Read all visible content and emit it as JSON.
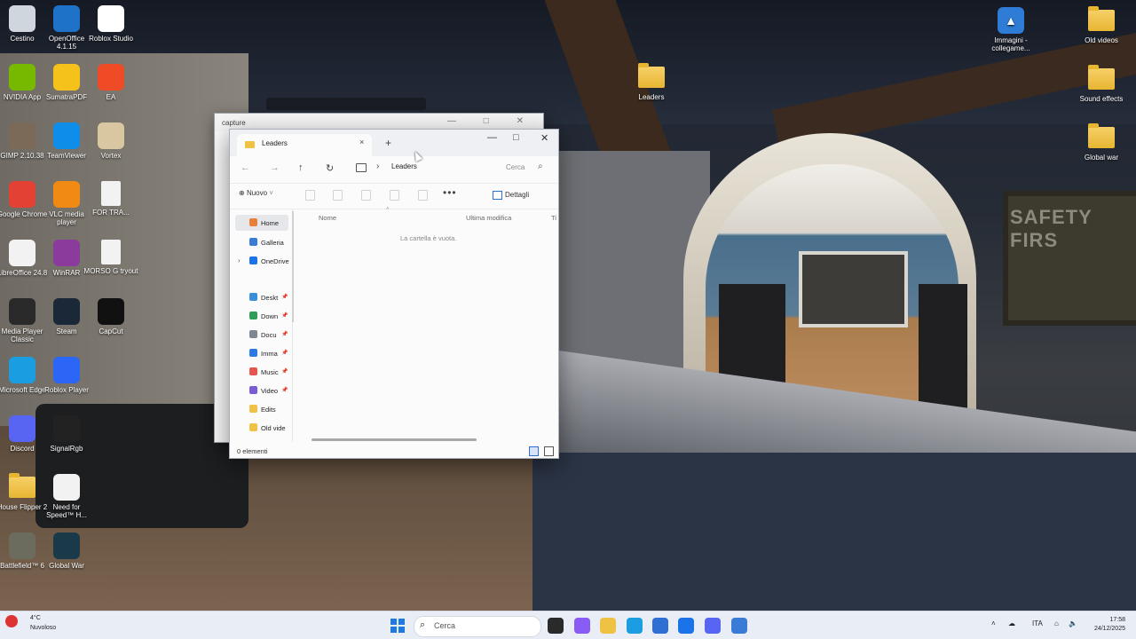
{
  "desktop_icons_left": [
    {
      "label": "Cestino",
      "icon": "recycle-bin-icon",
      "color": "#cfd6dd"
    },
    {
      "label": "OpenOffice 4.1.15",
      "icon": "openoffice-icon",
      "color": "#1e72c8"
    },
    {
      "label": "Roblox Studio",
      "icon": "roblox-studio-icon",
      "color": "#ffffff"
    },
    {
      "label": "NVIDIA App",
      "icon": "nvidia-icon",
      "color": "#76b900"
    },
    {
      "label": "SumatraPDF",
      "icon": "pdf-icon",
      "color": "#f4c21b"
    },
    {
      "label": "EA",
      "icon": "ea-icon",
      "color": "#ef4b26"
    },
    {
      "label": "GIMP 2.10.38",
      "icon": "gimp-icon",
      "color": "#7b6a57"
    },
    {
      "label": "TeamViewer",
      "icon": "teamviewer-icon",
      "color": "#0e8ee9"
    },
    {
      "label": "Vortex",
      "icon": "vortex-icon",
      "color": "#d8c7a0"
    },
    {
      "label": "Google Chrome",
      "icon": "chrome-icon",
      "color": "#e34133"
    },
    {
      "label": "VLC media player",
      "icon": "vlc-icon",
      "color": "#f08a12"
    },
    {
      "label": "FOR TRA...",
      "icon": "document-icon",
      "color": "#f2f2f2"
    },
    {
      "label": "LibreOffice 24.8",
      "icon": "libreoffice-icon",
      "color": "#f2f2f2"
    },
    {
      "label": "WinRAR",
      "icon": "winrar-icon",
      "color": "#8b3b9b"
    },
    {
      "label": "MORSO G tryout",
      "icon": "document-icon",
      "color": "#f2f2f2"
    },
    {
      "label": "Media Player Classic",
      "icon": "mpc-icon",
      "color": "#2a2a2a"
    },
    {
      "label": "Steam",
      "icon": "steam-icon",
      "color": "#1b2838"
    },
    {
      "label": "CapCut",
      "icon": "capcut-icon",
      "color": "#111111"
    },
    {
      "label": "Microsoft Edge",
      "icon": "edge-icon",
      "color": "#1b9de2"
    },
    {
      "label": "Roblox Player",
      "icon": "roblox-player-icon",
      "color": "#2b66f6"
    },
    {
      "label": "Discord",
      "icon": "discord-icon",
      "color": "#5865f2"
    },
    {
      "label": "SignalRgb",
      "icon": "signalrgb-icon",
      "color": "#222222"
    },
    {
      "label": "House Flipper 2",
      "icon": "folder-icon",
      "color": "#f0c244"
    },
    {
      "label": "Need for Speed™ H...",
      "icon": "nfs-icon",
      "color": "#f2f2f2"
    },
    {
      "label": "Battlefield™ 6",
      "icon": "battlefield-icon",
      "color": "#6b6b5e"
    },
    {
      "label": "Global War",
      "icon": "global-war-icon",
      "color": "#1a3a4a"
    }
  ],
  "desktop_icons_right": [
    {
      "label": "Leaders",
      "icon": "folder-icon"
    },
    {
      "label": "Immagini - collegame...",
      "icon": "pictures-shortcut-icon"
    },
    {
      "label": "Old videos",
      "icon": "folder-icon"
    },
    {
      "label": "Sound effects",
      "icon": "folder-icon"
    },
    {
      "label": "Global war",
      "icon": "folder-icon"
    }
  ],
  "wallpaper": {
    "sign_text": "SAFETY FIRS"
  },
  "back_window": {
    "tab_label": "capture"
  },
  "explorer": {
    "tab_label": "Leaders",
    "tab_close": "×",
    "tab_add": "+",
    "window_controls": {
      "minimize": "—",
      "maximize": "□",
      "close": "✕"
    },
    "nav": {
      "back": "←",
      "forward": "→",
      "up": "↑",
      "refresh": "↻"
    },
    "breadcrumb_sep": "›",
    "breadcrumb": "Leaders",
    "search_placeholder": "Cerca",
    "search_icon": "⌕",
    "new_label": "Nuovo",
    "more_label": "•••",
    "details_label": "Dettagli",
    "sidebar": [
      {
        "label": "Home",
        "icon": "home-icon",
        "color": "#e8803a",
        "active": true
      },
      {
        "label": "Galleria",
        "icon": "gallery-icon",
        "color": "#3a7bd5"
      },
      {
        "label": "OneDrive",
        "icon": "onedrive-icon",
        "color": "#1a73e8",
        "expander": "›"
      },
      {
        "label": "Deskt",
        "icon": "desktop-icon",
        "color": "#3b8fd9",
        "pin": "📌"
      },
      {
        "label": "Down",
        "icon": "download-icon",
        "color": "#2f9e5b",
        "pin": "📌"
      },
      {
        "label": "Docu",
        "icon": "documents-icon",
        "color": "#7d8894",
        "pin": "📌"
      },
      {
        "label": "Imma",
        "icon": "pictures-icon",
        "color": "#2c7be5",
        "pin": "📌"
      },
      {
        "label": "Music",
        "icon": "music-icon",
        "color": "#e5554f",
        "pin": "📌"
      },
      {
        "label": "Video",
        "icon": "videos-icon",
        "color": "#7a5cd6",
        "pin": "📌"
      },
      {
        "label": "Edits",
        "icon": "folder-icon",
        "color": "#f0c244"
      },
      {
        "label": "Old vide",
        "icon": "folder-icon",
        "color": "#f0c244"
      }
    ],
    "columns": {
      "name": "Nome",
      "modified": "Ultima modifica",
      "type": "Ti"
    },
    "empty_message": "La cartella è vuota.",
    "status": "0 elementi"
  },
  "taskbar": {
    "weather_temp": "4°C",
    "weather_desc": "Nuvoloso",
    "search_placeholder": "Cerca",
    "language": "ITA",
    "time": "17:58",
    "date": "24/12/2025",
    "apps": [
      {
        "name": "task-view-icon",
        "color": "#2a2a2a"
      },
      {
        "name": "copilot-icon",
        "color": "#8a5cf6"
      },
      {
        "name": "file-explorer-icon",
        "color": "#f0c244"
      },
      {
        "name": "edge-icon",
        "color": "#1b9de2"
      },
      {
        "name": "store-icon",
        "color": "#2f6fd3"
      },
      {
        "name": "outlook-icon",
        "color": "#1a73e8"
      },
      {
        "name": "discord-icon",
        "color": "#5865f2"
      },
      {
        "name": "snipping-tool-icon",
        "color": "#3a7bd5"
      }
    ]
  }
}
